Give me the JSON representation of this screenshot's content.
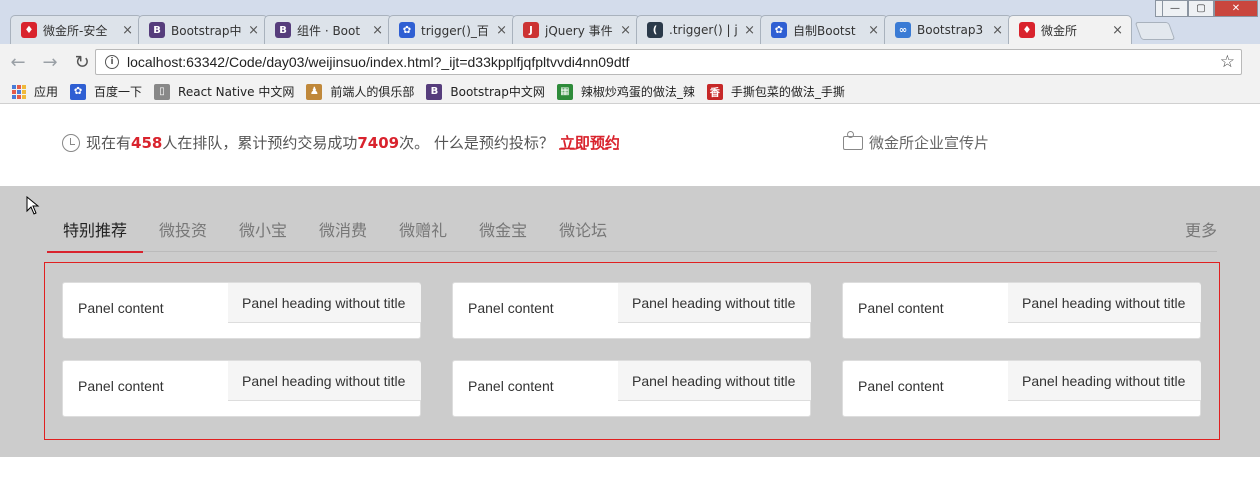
{
  "tabs": [
    {
      "title": "微金所-安全",
      "icon": "weijinsuo-logo",
      "color": "#d9232d",
      "glyph": "♦"
    },
    {
      "title": "Bootstrap中",
      "icon": "bootstrap-logo",
      "color": "#563d7c",
      "glyph": "B"
    },
    {
      "title": "组件 · Boot",
      "icon": "bootstrap-logo",
      "color": "#563d7c",
      "glyph": "B"
    },
    {
      "title": "trigger()_百",
      "icon": "baidu-paw",
      "color": "#2f5fd3",
      "glyph": "✿"
    },
    {
      "title": "jQuery 事件",
      "icon": "jquery-logo",
      "color": "#cc3333",
      "glyph": "J"
    },
    {
      "title": ".trigger() | j",
      "icon": "jquery-api-logo",
      "color": "#2b3a4a",
      "glyph": "("
    },
    {
      "title": "自制Bootst",
      "icon": "baidu-paw",
      "color": "#2f5fd3",
      "glyph": "✿"
    },
    {
      "title": "Bootstrap3",
      "icon": "cloud-logo",
      "color": "#3a7bd5",
      "glyph": "∞"
    },
    {
      "title": "微金所",
      "icon": "weijinsuo-logo",
      "color": "#d9232d",
      "glyph": "♦"
    }
  ],
  "close_glyph": "×",
  "toolbar": {
    "back": "←",
    "forward": "→",
    "reload": "↻",
    "url": "localhost:63342/Code/day03/weijinsuo/index.html?_ijt=d33kpplfjqfpltvvdi4nn09dtf",
    "star": "☆"
  },
  "bookmarks": [
    {
      "label": "应用",
      "icon": "apps-grid-icon"
    },
    {
      "label": "百度一下",
      "icon": "baidu-paw-icon",
      "color": "#2f5fd3",
      "glyph": "✿"
    },
    {
      "label": "React Native 中文网",
      "icon": "page-icon",
      "color": "#888888",
      "glyph": "▯"
    },
    {
      "label": "前端人的俱乐部",
      "icon": "person-icon",
      "color": "#c0883a",
      "glyph": "♟"
    },
    {
      "label": "Bootstrap中文网",
      "icon": "bootstrap-icon",
      "color": "#563d7c",
      "glyph": "B"
    },
    {
      "label": "辣椒炒鸡蛋的做法_辣",
      "icon": "recipe-icon",
      "color": "#2e8b3a",
      "glyph": "▦"
    },
    {
      "label": "手撕包菜的做法_手撕",
      "icon": "xiachufang-icon",
      "color": "#c62828",
      "glyph": "香"
    }
  ],
  "page": {
    "queue_prefix": "现在有",
    "queue_count": "458",
    "queue_mid": "人在排队，累计预约交易成功 ",
    "success_count": "7409",
    "queue_suffix": "次。 什么是预约投标？",
    "cta": "立即预约",
    "promo": "微金所企业宣传片"
  },
  "categories": [
    "特别推荐",
    "微投资",
    "微小宝",
    "微消费",
    "微赠礼",
    "微金宝",
    "微论坛"
  ],
  "more": "更多",
  "panels": [
    {
      "content": "Panel content",
      "heading": "Panel heading without title"
    },
    {
      "content": "Panel content",
      "heading": "Panel heading without title"
    },
    {
      "content": "Panel content",
      "heading": "Panel heading without title"
    },
    {
      "content": "Panel content",
      "heading": "Panel heading without title"
    },
    {
      "content": "Panel content",
      "heading": "Panel heading without title"
    },
    {
      "content": "Panel content",
      "heading": "Panel heading without title"
    }
  ]
}
